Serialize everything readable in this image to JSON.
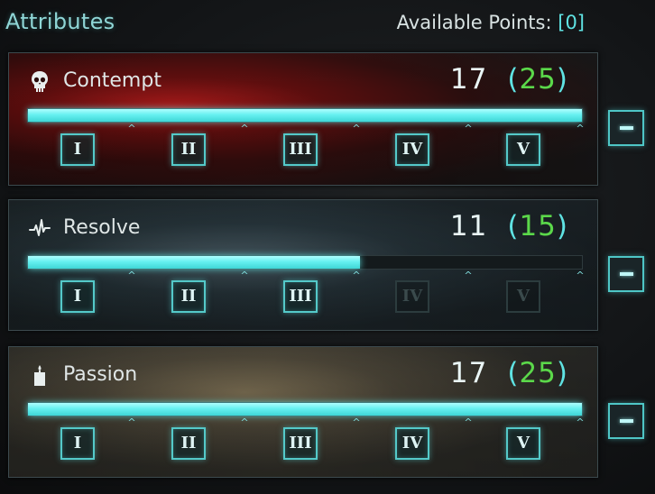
{
  "header": {
    "title": "Attributes",
    "available_label": "Available Points:",
    "available_value": "[0]"
  },
  "attributes": [
    {
      "name": "Contempt",
      "icon": "skull-icon",
      "current": "17",
      "max": "25",
      "fill_fraction": 1.0,
      "ranks": [
        "I",
        "II",
        "III",
        "IV",
        "V"
      ],
      "ranks_unlocked": [
        true,
        true,
        true,
        true,
        true
      ]
    },
    {
      "name": "Resolve",
      "icon": "heartbeat-icon",
      "current": "11",
      "max": "15",
      "fill_fraction": 0.6,
      "ranks": [
        "I",
        "II",
        "III",
        "IV",
        "V"
      ],
      "ranks_unlocked": [
        true,
        true,
        true,
        false,
        false
      ]
    },
    {
      "name": "Passion",
      "icon": "candle-icon",
      "current": "17",
      "max": "25",
      "fill_fraction": 1.0,
      "ranks": [
        "I",
        "II",
        "III",
        "IV",
        "V"
      ],
      "ranks_unlocked": [
        true,
        true,
        true,
        true,
        true
      ]
    }
  ],
  "colors": {
    "accent": "#5fe3e3",
    "max_value": "#5bd84a",
    "bar_fill": "#66f0f0"
  }
}
